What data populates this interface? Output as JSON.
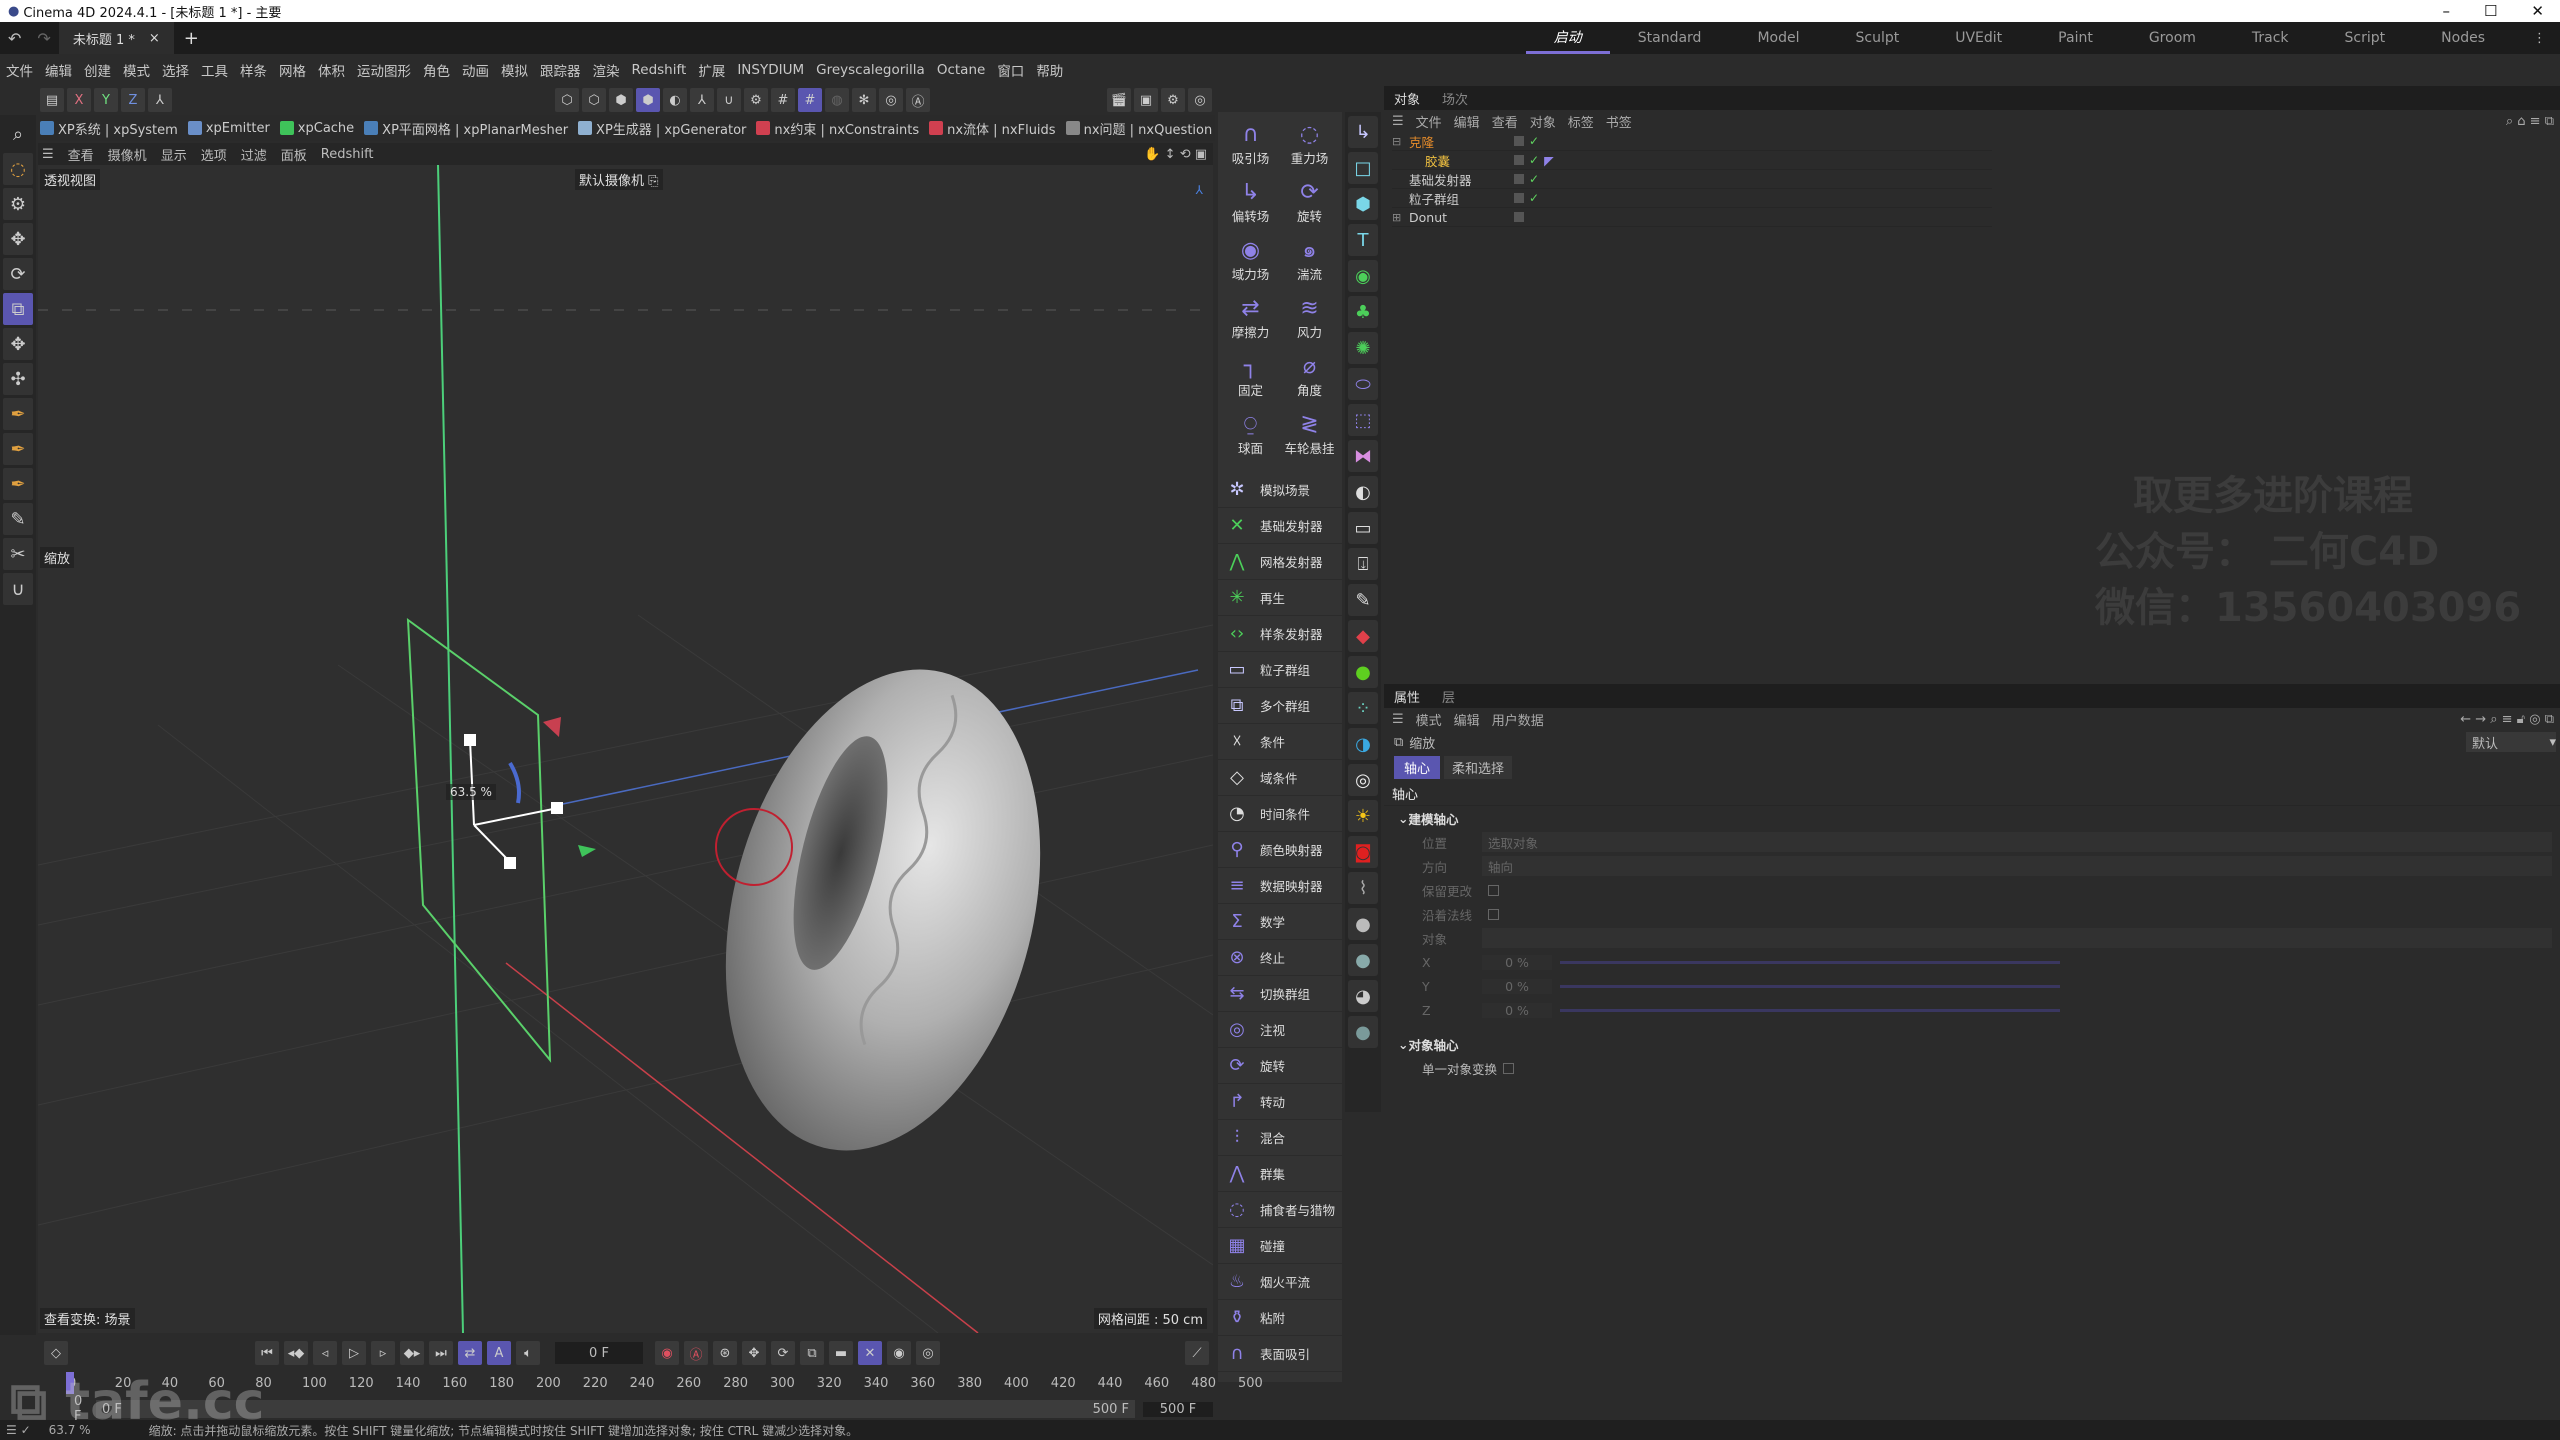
{
  "window": {
    "title": "Cinema 4D 2024.4.1 - [未标题 1 *] - 主要",
    "minimize": "–",
    "maximize": "☐",
    "close": "✕"
  },
  "tabs": {
    "doc": "未标题 1 *",
    "close": "×",
    "add": "+",
    "layouts": [
      "启动",
      "Standard",
      "Model",
      "Sculpt",
      "UVEdit",
      "Paint",
      "Groom",
      "Track",
      "Script",
      "Nodes"
    ]
  },
  "menu": [
    "文件",
    "编辑",
    "创建",
    "模式",
    "选择",
    "工具",
    "样条",
    "网格",
    "体积",
    "运动图形",
    "角色",
    "动画",
    "模拟",
    "跟踪器",
    "渲染",
    "Redshift",
    "扩展",
    "INSYDIUM",
    "Greyscalegorilla",
    "Octane",
    "窗口",
    "帮助"
  ],
  "axis_lock": [
    "X",
    "Y",
    "Z"
  ],
  "plugins": [
    {
      "label": "XP系统 | xpSystem",
      "color": "#4a7fb8"
    },
    {
      "label": "xpEmitter",
      "color": "#6a8fc8"
    },
    {
      "label": "xpCache",
      "color": "#3fc35a"
    },
    {
      "label": "XP平面网格 | xpPlanarMesher",
      "color": "#4a7fb8"
    },
    {
      "label": "XP生成器 | xpGenerator",
      "color": "#8fb0d0"
    },
    {
      "label": "nx约束 | nxConstraints",
      "color": "#d04050"
    },
    {
      "label": "nx流体 | nxFluids",
      "color": "#d04050"
    },
    {
      "label": "nx问题 | nxQuestion",
      "color": "#888888"
    }
  ],
  "viewport": {
    "menu": [
      "查看",
      "摄像机",
      "显示",
      "选项",
      "过滤",
      "面板",
      "Redshift"
    ],
    "view_name": "透视视图",
    "camera": "默认摄像机 ⎘",
    "tool": "缩放",
    "scale_readout": "63.5 %",
    "transform": "查看变换: 场景",
    "grid": "网格间距 : 50 cm"
  },
  "palette_grid": [
    {
      "icon": "∩",
      "label": "吸引场"
    },
    {
      "icon": "◌",
      "label": "重力场"
    },
    {
      "icon": "↳",
      "label": "偏转场"
    },
    {
      "icon": "⟳",
      "label": "旋转"
    },
    {
      "icon": "◉",
      "label": "域力场"
    },
    {
      "icon": "๑",
      "label": "湍流"
    },
    {
      "icon": "⇄",
      "label": "摩擦力"
    },
    {
      "icon": "≋",
      "label": "风力"
    },
    {
      "icon": "┐",
      "label": "固定"
    },
    {
      "icon": "⌀",
      "label": "角度"
    },
    {
      "icon": "⍜",
      "label": "球面"
    },
    {
      "icon": "≷",
      "label": "车轮悬挂"
    }
  ],
  "palette_list": [
    {
      "icon": "✲",
      "label": "模拟场景",
      "color": "#c8c8ff"
    },
    {
      "icon": "✕",
      "label": "基础发射器",
      "color": "#4ccf5a"
    },
    {
      "icon": "⋀",
      "label": "网格发射器",
      "color": "#4ccf5a"
    },
    {
      "icon": "✳",
      "label": "再生",
      "color": "#4ccf5a"
    },
    {
      "icon": "‹›",
      "label": "样条发射器",
      "color": "#4ccf5a"
    },
    {
      "icon": "▭",
      "label": "粒子群组",
      "color": "#c8c8ff"
    },
    {
      "icon": "⧉",
      "label": "多个群组",
      "color": "#c8c8ff"
    },
    {
      "icon": "☓",
      "label": "条件",
      "color": "#ddd"
    },
    {
      "icon": "◇",
      "label": "域条件",
      "color": "#ddd"
    },
    {
      "icon": "◔",
      "label": "时间条件",
      "color": "#ddd"
    },
    {
      "icon": "⚲",
      "label": "颜色映射器",
      "color": "#8f82e8"
    },
    {
      "icon": "≡",
      "label": "数据映射器",
      "color": "#8f82e8"
    },
    {
      "icon": "Σ",
      "label": "数学",
      "color": "#8f82e8"
    },
    {
      "icon": "⊗",
      "label": "终止",
      "color": "#8f82e8"
    },
    {
      "icon": "⇆",
      "label": "切换群组",
      "color": "#8f82e8"
    },
    {
      "icon": "◎",
      "label": "注视",
      "color": "#8f82e8"
    },
    {
      "icon": "⟳",
      "label": "旋转",
      "color": "#8f82e8"
    },
    {
      "icon": "↱",
      "label": "转动",
      "color": "#8f82e8"
    },
    {
      "icon": "⫶",
      "label": "混合",
      "color": "#8f82e8"
    },
    {
      "icon": "⋀",
      "label": "群集",
      "color": "#8f82e8"
    },
    {
      "icon": "◌",
      "label": "捕食者与猎物",
      "color": "#8f82e8"
    },
    {
      "icon": "▦",
      "label": "碰撞",
      "color": "#8f82e8"
    },
    {
      "icon": "♨",
      "label": "烟火平流",
      "color": "#8f82e8"
    },
    {
      "icon": "⚱",
      "label": "粘附",
      "color": "#8f82e8"
    },
    {
      "icon": "∩",
      "label": "表面吸引",
      "color": "#8f82e8"
    }
  ],
  "icon_column": [
    {
      "icon": "↳",
      "color": "#c8c8ff"
    },
    {
      "icon": "□",
      "color": "#7ad7e8"
    },
    {
      "icon": "⬢",
      "color": "#7ad7e8"
    },
    {
      "icon": "T",
      "color": "#7ad7e8"
    },
    {
      "icon": "◉",
      "color": "#4ccf5a"
    },
    {
      "icon": "♣",
      "color": "#4ccf5a"
    },
    {
      "icon": "✺",
      "color": "#4ccf5a"
    },
    {
      "icon": "⬭",
      "color": "#8f82e8"
    },
    {
      "icon": "⬚",
      "color": "#8f82e8"
    },
    {
      "icon": "⧓",
      "color": "#d88ee0"
    },
    {
      "icon": "◐",
      "color": "#ddd"
    },
    {
      "icon": "▭",
      "color": "#ddd"
    },
    {
      "icon": "⍗",
      "color": "#ddd"
    },
    {
      "icon": "✎",
      "color": "#ddd"
    },
    {
      "icon": "◆",
      "color": "#e0404a"
    },
    {
      "icon": "●",
      "color": "#5ecf20"
    },
    {
      "icon": "⁘",
      "color": "#6ad0c0"
    },
    {
      "icon": "◑",
      "color": "#3aa8e0"
    },
    {
      "icon": "◎",
      "color": "#eee"
    },
    {
      "icon": "☀",
      "color": "#f5c518"
    },
    {
      "icon": "◙",
      "color": "#e02020"
    },
    {
      "icon": "⌇",
      "color": "#aaa"
    },
    {
      "icon": "●",
      "color": "#bbb"
    },
    {
      "icon": "●",
      "color": "#8aa"
    },
    {
      "icon": "◕",
      "color": "#ccc"
    },
    {
      "icon": "●",
      "color": "#7a9a9a"
    }
  ],
  "objects": {
    "tabs": [
      "对象",
      "场次"
    ],
    "menu": [
      "文件",
      "编辑",
      "查看",
      "对象",
      "标签",
      "书签"
    ],
    "items": [
      {
        "name": "克隆",
        "color": "#e38a2a",
        "indent": 0,
        "expand": "⊟"
      },
      {
        "name": "胶囊",
        "color": "#f0c040",
        "indent": 1,
        "expand": ""
      },
      {
        "name": "基础发射器",
        "color": "#cccccc",
        "indent": 0,
        "expand": ""
      },
      {
        "name": "粒子群组",
        "color": "#cccccc",
        "indent": 0,
        "expand": ""
      },
      {
        "name": "Donut",
        "color": "#cccccc",
        "indent": 0,
        "expand": "⊞"
      }
    ]
  },
  "watermark": [
    "取更多进阶课程",
    "公众号：  二何C4D",
    "微信：13560403096"
  ],
  "attributes": {
    "tabs": [
      "属性",
      "层"
    ],
    "menu": [
      "模式",
      "编辑",
      "用户数据"
    ],
    "tool": "缩放",
    "preset": "默认",
    "subtabs": [
      "轴心",
      "柔和选择"
    ],
    "section": "轴心",
    "group1": "建模轴心",
    "position_label": "位置",
    "position_value": "选取对象",
    "direction_label": "方向",
    "direction_value": "轴向",
    "keep_changes": "保留更改",
    "along_normals": "沿着法线",
    "object_label": "对象",
    "axes": [
      {
        "label": "X",
        "value": "0 %"
      },
      {
        "label": "Y",
        "value": "0 %"
      },
      {
        "label": "Z",
        "value": "0 %"
      }
    ],
    "group2": "对象轴心",
    "single_object": "单一对象变换"
  },
  "timeline": {
    "current_frame": "0 F",
    "ticks": [
      0,
      20,
      40,
      60,
      80,
      100,
      120,
      140,
      160,
      180,
      200,
      220,
      240,
      260,
      280,
      300,
      320,
      340,
      360,
      380,
      400,
      420,
      440,
      460,
      480,
      500
    ],
    "range_start": "0 F",
    "range_start2": "0 F",
    "range_end": "500 F",
    "max": "500 F"
  },
  "status": {
    "zoom": "63.7 %",
    "hint": "缩放: 点击并拖动鼠标缩放元素。按住 SHIFT 键量化缩放; 节点编辑模式时按住 SHIFT 键增加选择对象; 按住 CTRL 键减少选择对象。"
  },
  "logo_watermark": "tafe.cc",
  "colors": {
    "accent": "#5a56b0",
    "x_axis": "#d0404a",
    "y_axis": "#4ccf5a",
    "z_axis": "#4a70d0"
  }
}
